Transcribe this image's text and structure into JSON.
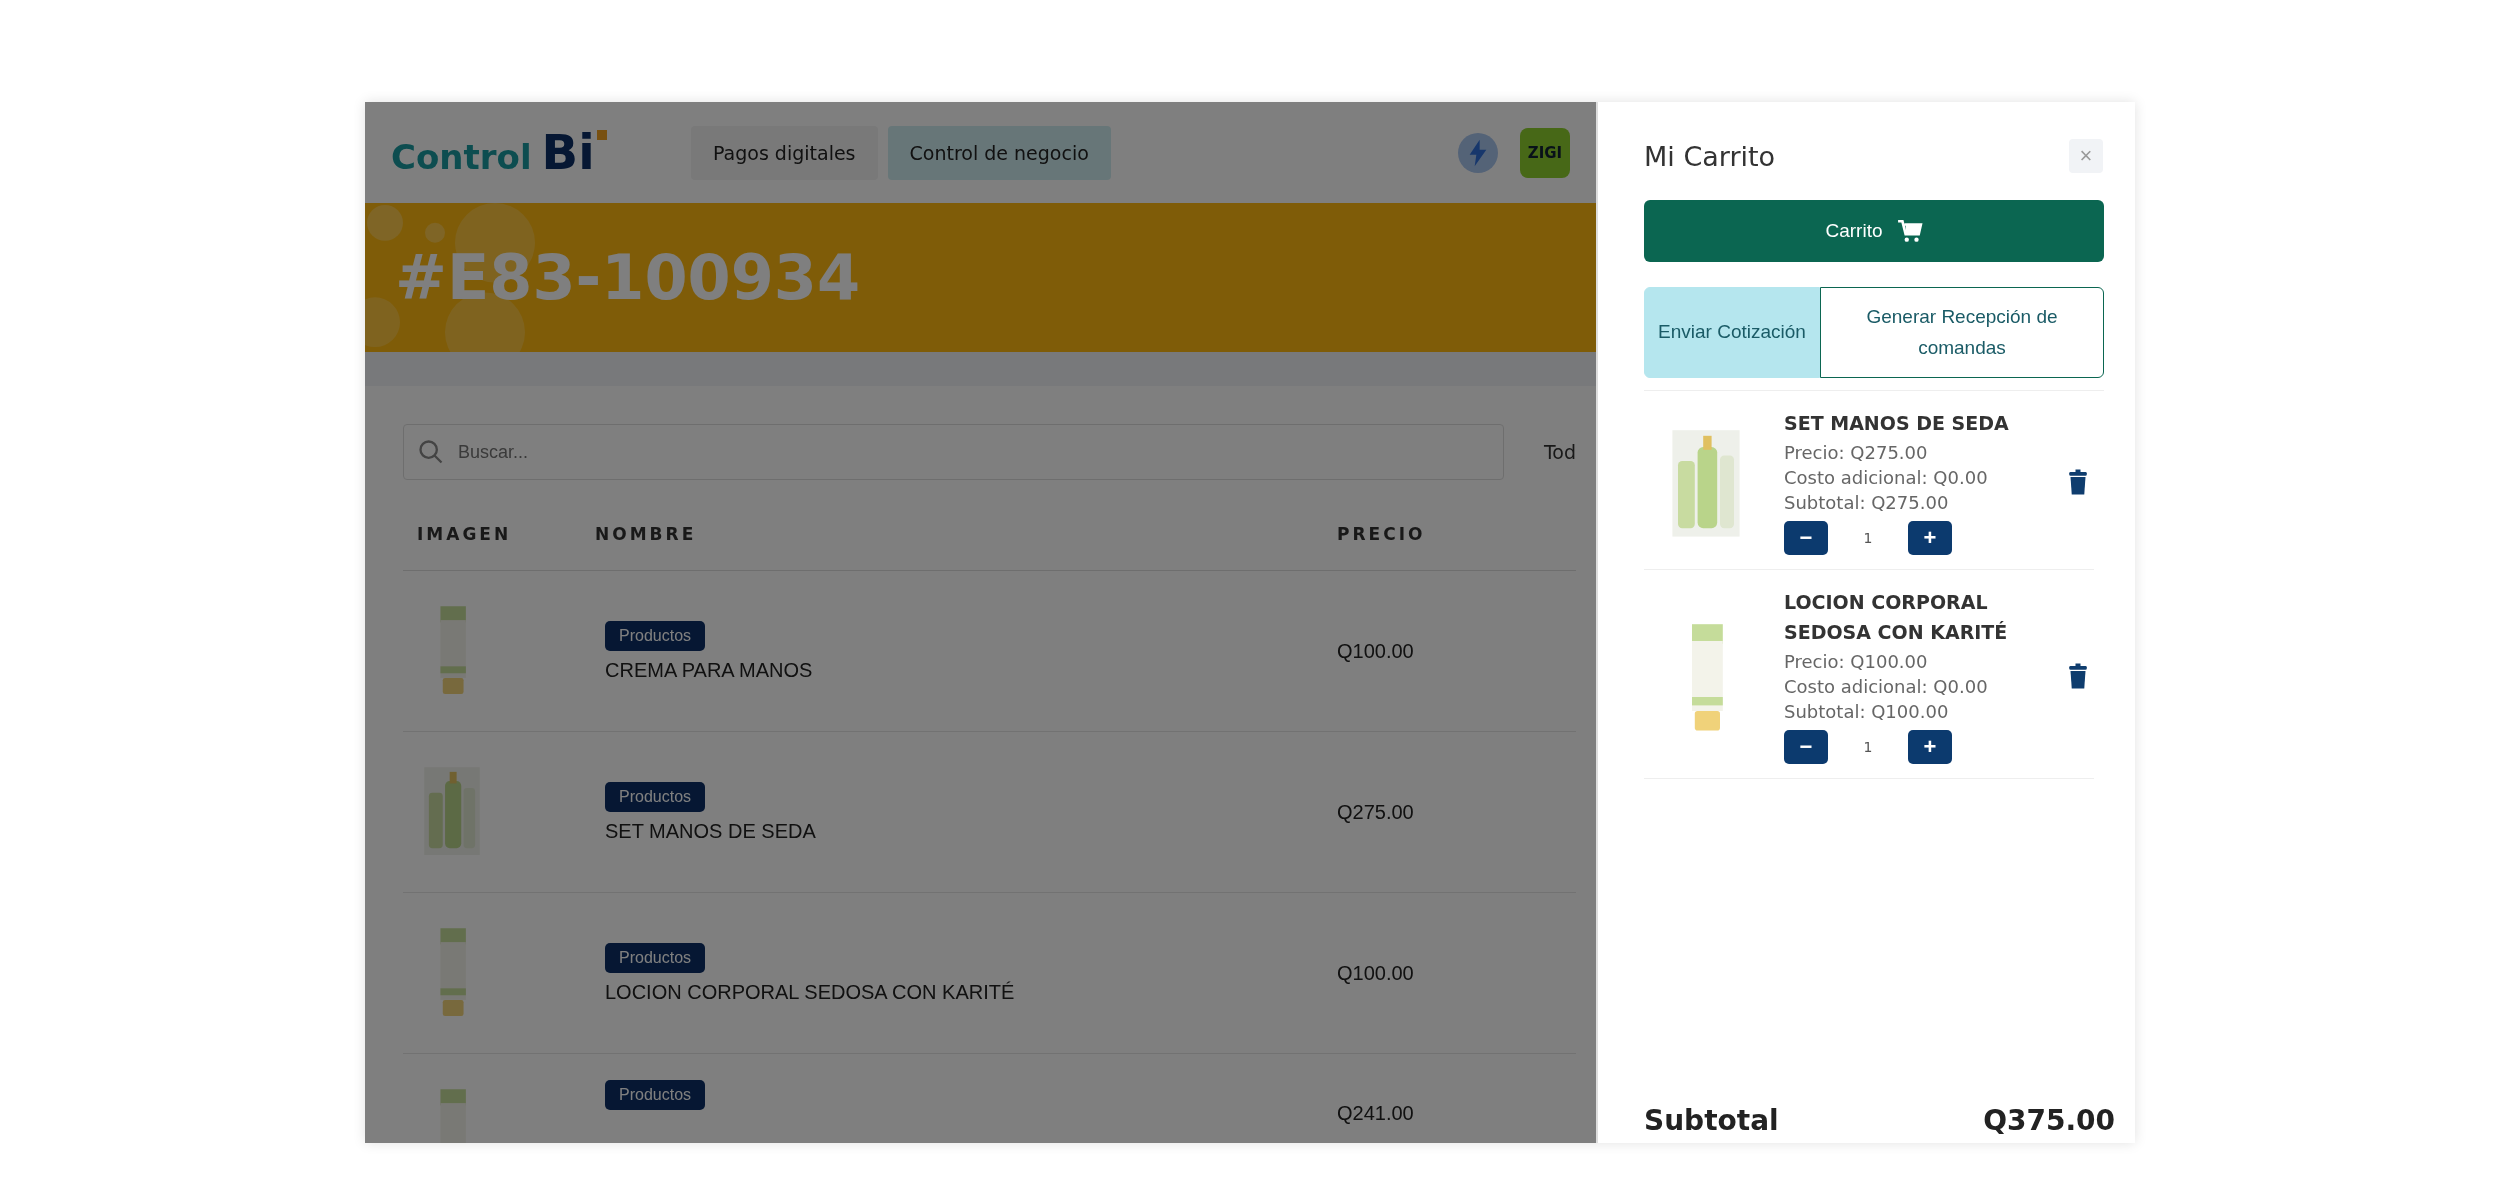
{
  "logo": {
    "text": "Control",
    "mark": "Bi"
  },
  "nav": [
    {
      "label": "Pagos digitales",
      "selected": false
    },
    {
      "label": "Control de negocio",
      "selected": true
    }
  ],
  "user": {
    "avatar": "ZIGI"
  },
  "banner": {
    "title": "#E83-100934"
  },
  "search": {
    "placeholder": "Buscar..."
  },
  "filter": {
    "value": "Tod"
  },
  "table": {
    "columns": [
      "IMAGEN",
      "NOMBRE",
      "PRECIO"
    ],
    "rows": [
      {
        "badge": "Productos",
        "name": "CREMA PARA MANOS",
        "price": "Q100.00"
      },
      {
        "badge": "Productos",
        "name": "SET MANOS DE SEDA",
        "price": "Q275.00"
      },
      {
        "badge": "Productos",
        "name": "LOCION CORPORAL SEDOSA CON KARITÉ",
        "price": "Q100.00"
      },
      {
        "badge": "Productos",
        "price": "Q241.00"
      }
    ]
  },
  "cart": {
    "title": "Mi Carrito",
    "close": "×",
    "button": "Carrito",
    "tabs": [
      {
        "label": "Enviar Cotización",
        "selected": true
      },
      {
        "label": "Generar Recepción de comandas",
        "selected": false
      }
    ],
    "items": [
      {
        "name": "SET MANOS DE SEDA",
        "price": "Precio: Q275.00",
        "extra": "Costo adicional: Q0.00",
        "subtotal": "Subtotal: Q275.00",
        "minus": "−",
        "qty": "1",
        "plus": "+"
      },
      {
        "name": "LOCION CORPORAL SEDOSA CON KARITÉ",
        "price": "Precio: Q100.00",
        "extra": "Costo adicional: Q0.00",
        "subtotal": "Subtotal: Q100.00",
        "minus": "−",
        "qty": "1",
        "plus": "+"
      }
    ],
    "subtotal_label": "Subtotal",
    "subtotal_value": "Q375.00"
  }
}
